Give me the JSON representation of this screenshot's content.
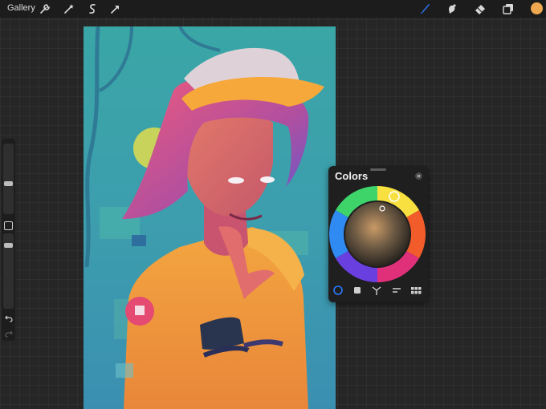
{
  "toolbar": {
    "gallery_label": "Gallery",
    "left_tools": [
      "wrench-icon",
      "magic-wand-icon",
      "selection-icon",
      "transform-arrow-icon"
    ],
    "right_tools": [
      "brush-icon",
      "smudge-icon",
      "eraser-icon",
      "layers-icon"
    ],
    "active_tool": "brush-icon",
    "current_color": "#f0a850"
  },
  "colors_panel": {
    "title": "Colors",
    "tabs": [
      "disc-tab",
      "classic-tab",
      "harmony-tab",
      "value-tab",
      "palettes-tab"
    ],
    "active_tab": "disc-tab"
  },
  "colors": {
    "accent": "#2a7bff",
    "panel_bg": "#1f1f1f",
    "topbar_bg": "#1c1c1c"
  }
}
